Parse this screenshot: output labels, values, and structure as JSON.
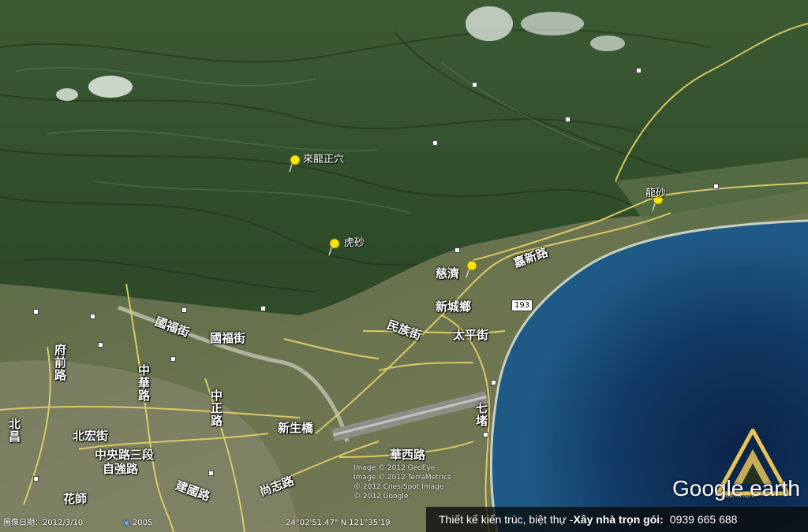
{
  "map": {
    "pins": [
      {
        "label": "來龍正穴"
      },
      {
        "label": "虎砂"
      },
      {
        "label": "龍砂"
      },
      {
        "label": "慈濟"
      }
    ],
    "roads": [
      {
        "label": "國福街"
      },
      {
        "label": "國福街"
      },
      {
        "label": "北宏街"
      },
      {
        "label": "中央路三段"
      },
      {
        "label": "自強路"
      },
      {
        "label": "新生橋"
      },
      {
        "label": "華西路"
      },
      {
        "label": "中正路"
      },
      {
        "label": "慈濟"
      },
      {
        "label": "新城鄉"
      },
      {
        "label": "嘉新路"
      },
      {
        "label": "太平街"
      },
      {
        "label": "民族街"
      },
      {
        "label": "中華路"
      },
      {
        "label": "府前路"
      },
      {
        "label": "尚志路"
      },
      {
        "label": "建國路"
      },
      {
        "label": "北昌"
      },
      {
        "label": "花師"
      },
      {
        "label": "七堵"
      }
    ],
    "highway_shield": "193",
    "credits": [
      "Image © 2012 GeoEye",
      "Image © 2012 TerraMetrics",
      "© 2012 Cnes/Spot Image",
      "© 2012 Google"
    ]
  },
  "status_bar": {
    "image_date": "圖像日期：2012/3/10",
    "year": "2005",
    "coordinates": "24°02'51.47\" N 121°35'19"
  },
  "brand": {
    "logo_text": "Google earth",
    "watermark_text": "VIBE ARCHI"
  },
  "promo": {
    "text_part1": "Thiết kế kiến trúc, biệt thự - ",
    "text_bold": "Xây nhà trọn gói:",
    "phone": "0939 665 688"
  },
  "colors": {
    "forest": "#2f4d2c",
    "sea": "#0d2a4e",
    "road": "#e6d36a",
    "pin": "#f5e50f"
  }
}
